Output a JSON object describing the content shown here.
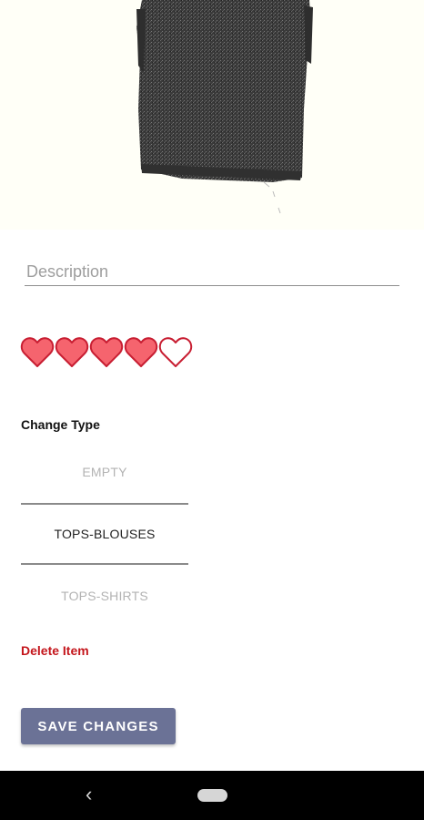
{
  "item_photo": {
    "alt_icon": "dark-knit-top-image"
  },
  "description": {
    "placeholder": "Description",
    "value": ""
  },
  "rating": {
    "value": 4,
    "max": 5,
    "fill_color": "#f5646e",
    "outline_color": "#c81e32"
  },
  "type_picker": {
    "label": "Change Type",
    "options": [
      "EMPTY",
      "TOPS-BLOUSES",
      "TOPS-SHIRTS"
    ],
    "selected": "TOPS-BLOUSES"
  },
  "actions": {
    "delete_label": "Delete Item",
    "save_label": "SAVE CHANGES"
  },
  "colors": {
    "delete": "#c4161c",
    "save_button": "#6b7296"
  },
  "nav": {
    "back_icon": "back-chevron-icon",
    "home_icon": "home-pill-icon"
  }
}
